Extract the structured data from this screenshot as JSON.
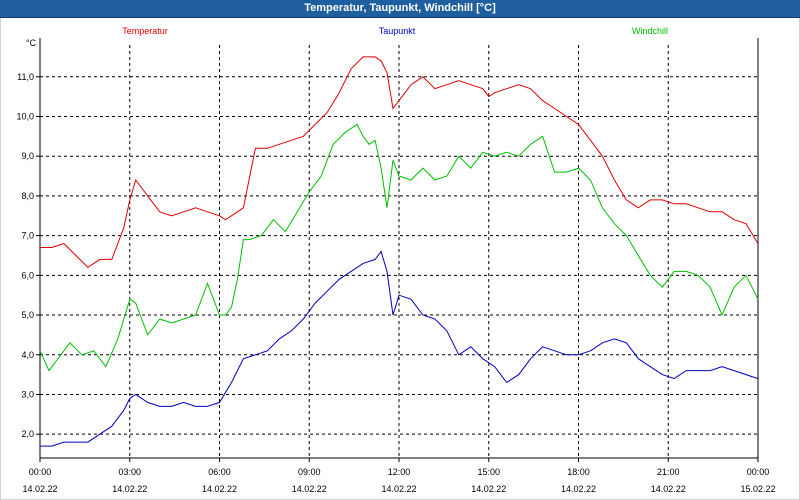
{
  "window": {
    "title": "Temperatur, Taupunkt, Windchill [°C]"
  },
  "chart_data": {
    "type": "line",
    "title": "Temperatur, Taupunkt, Windchill [°C]",
    "ylabel": "°C",
    "ylim": [
      1.4,
      11.8
    ],
    "y_ticks": [
      "2,0",
      "3,0",
      "4,0",
      "5,0",
      "6,0",
      "7,0",
      "8,0",
      "9,0",
      "10,0",
      "11,0"
    ],
    "xlim": [
      0,
      24
    ],
    "x_ticks": [
      {
        "time": "00:00",
        "date": "14.02.22"
      },
      {
        "time": "03:00",
        "date": "14.02.22"
      },
      {
        "time": "06:00",
        "date": "14.02.22"
      },
      {
        "time": "09:00",
        "date": "14.02.22"
      },
      {
        "time": "12:00",
        "date": "14.02.22"
      },
      {
        "time": "15:00",
        "date": "14.02.22"
      },
      {
        "time": "18:00",
        "date": "14.02.22"
      },
      {
        "time": "21:00",
        "date": "14.02.22"
      },
      {
        "time": "00:00",
        "date": "15.02.22"
      }
    ],
    "grid": true,
    "legend_position": "top",
    "series": [
      {
        "name": "Temperatur",
        "color": "#e00000",
        "x": [
          0,
          0.4,
          0.8,
          1.2,
          1.6,
          2.0,
          2.4,
          2.8,
          3.0,
          3.2,
          3.6,
          4.0,
          4.4,
          4.8,
          5.2,
          5.6,
          6.0,
          6.2,
          6.4,
          6.6,
          6.8,
          7.2,
          7.6,
          8.0,
          8.4,
          8.8,
          9.2,
          9.6,
          10.0,
          10.4,
          10.8,
          11.2,
          11.4,
          11.6,
          11.8,
          12.0,
          12.2,
          12.4,
          12.8,
          13.2,
          13.6,
          14.0,
          14.4,
          14.8,
          15.0,
          15.2,
          15.6,
          16.0,
          16.4,
          16.8,
          17.2,
          17.6,
          18.0,
          18.4,
          18.8,
          19.2,
          19.6,
          20.0,
          20.4,
          20.8,
          21.2,
          21.6,
          22.0,
          22.4,
          22.8,
          23.2,
          23.6,
          24.0
        ],
        "values": [
          6.7,
          6.7,
          6.8,
          6.5,
          6.2,
          6.4,
          6.4,
          7.2,
          7.9,
          8.4,
          8.0,
          7.6,
          7.5,
          7.6,
          7.7,
          7.6,
          7.5,
          7.4,
          7.5,
          7.6,
          7.7,
          9.2,
          9.2,
          9.3,
          9.4,
          9.5,
          9.8,
          10.1,
          10.6,
          11.2,
          11.5,
          11.5,
          11.4,
          11.1,
          10.2,
          10.4,
          10.6,
          10.8,
          11.0,
          10.7,
          10.8,
          10.9,
          10.8,
          10.7,
          10.5,
          10.6,
          10.7,
          10.8,
          10.7,
          10.4,
          10.2,
          10.0,
          9.8,
          9.4,
          9.0,
          8.4,
          7.9,
          7.7,
          7.9,
          7.9,
          7.8,
          7.8,
          7.7,
          7.6,
          7.6,
          7.4,
          7.3,
          6.8
        ]
      },
      {
        "name": "Taupunkt",
        "color": "#0000c0",
        "x": [
          0,
          0.4,
          0.8,
          1.2,
          1.6,
          2.0,
          2.4,
          2.8,
          3.0,
          3.2,
          3.6,
          4.0,
          4.4,
          4.8,
          5.2,
          5.6,
          6.0,
          6.4,
          6.8,
          7.2,
          7.6,
          8.0,
          8.4,
          8.8,
          9.2,
          9.6,
          10.0,
          10.4,
          10.8,
          11.2,
          11.4,
          11.6,
          11.8,
          12.0,
          12.4,
          12.8,
          13.2,
          13.6,
          14.0,
          14.4,
          14.8,
          15.2,
          15.6,
          16.0,
          16.4,
          16.8,
          17.2,
          17.6,
          18.0,
          18.4,
          18.8,
          19.2,
          19.6,
          20.0,
          20.4,
          20.8,
          21.2,
          21.6,
          22.0,
          22.4,
          22.8,
          23.2,
          23.6,
          24.0
        ],
        "values": [
          1.7,
          1.7,
          1.8,
          1.8,
          1.8,
          2.0,
          2.2,
          2.6,
          2.9,
          3.0,
          2.8,
          2.7,
          2.7,
          2.8,
          2.7,
          2.7,
          2.8,
          3.3,
          3.9,
          4.0,
          4.1,
          4.4,
          4.6,
          4.9,
          5.3,
          5.6,
          5.9,
          6.1,
          6.3,
          6.4,
          6.6,
          6.1,
          5.0,
          5.5,
          5.4,
          5.0,
          4.9,
          4.6,
          4.0,
          4.2,
          3.9,
          3.7,
          3.3,
          3.5,
          3.9,
          4.2,
          4.1,
          4.0,
          4.0,
          4.1,
          4.3,
          4.4,
          4.3,
          3.9,
          3.7,
          3.5,
          3.4,
          3.6,
          3.6,
          3.6,
          3.7,
          3.6,
          3.5,
          3.4
        ]
      },
      {
        "name": "Windchill",
        "color": "#00c000",
        "x": [
          0,
          0.3,
          0.6,
          1.0,
          1.4,
          1.8,
          2.2,
          2.6,
          2.8,
          3.0,
          3.2,
          3.4,
          3.6,
          4.0,
          4.4,
          4.8,
          5.2,
          5.6,
          6.0,
          6.2,
          6.4,
          6.6,
          6.8,
          7.0,
          7.4,
          7.8,
          8.2,
          8.6,
          9.0,
          9.4,
          9.8,
          10.2,
          10.6,
          10.8,
          11.0,
          11.2,
          11.4,
          11.6,
          11.8,
          12.0,
          12.4,
          12.8,
          13.2,
          13.6,
          14.0,
          14.4,
          14.8,
          15.2,
          15.6,
          16.0,
          16.4,
          16.8,
          17.2,
          17.6,
          18.0,
          18.4,
          18.8,
          19.2,
          19.6,
          20.0,
          20.4,
          20.8,
          21.2,
          21.6,
          22.0,
          22.4,
          22.8,
          23.2,
          23.6,
          24.0
        ],
        "values": [
          4.1,
          3.6,
          3.9,
          4.3,
          4.0,
          4.1,
          3.7,
          4.4,
          4.9,
          5.4,
          5.3,
          4.9,
          4.5,
          4.9,
          4.8,
          4.9,
          5.0,
          5.8,
          5.0,
          5.0,
          5.2,
          5.9,
          6.9,
          6.9,
          7.0,
          7.4,
          7.1,
          7.6,
          8.1,
          8.5,
          9.3,
          9.6,
          9.8,
          9.5,
          9.3,
          9.4,
          8.7,
          7.7,
          8.9,
          8.5,
          8.4,
          8.7,
          8.4,
          8.5,
          9.0,
          8.7,
          9.1,
          9.0,
          9.1,
          9.0,
          9.3,
          9.5,
          8.6,
          8.6,
          8.7,
          8.4,
          7.7,
          7.3,
          7.0,
          6.5,
          6.0,
          5.7,
          6.1,
          6.1,
          6.0,
          5.7,
          5.0,
          5.7,
          6.0,
          5.4
        ]
      }
    ]
  }
}
